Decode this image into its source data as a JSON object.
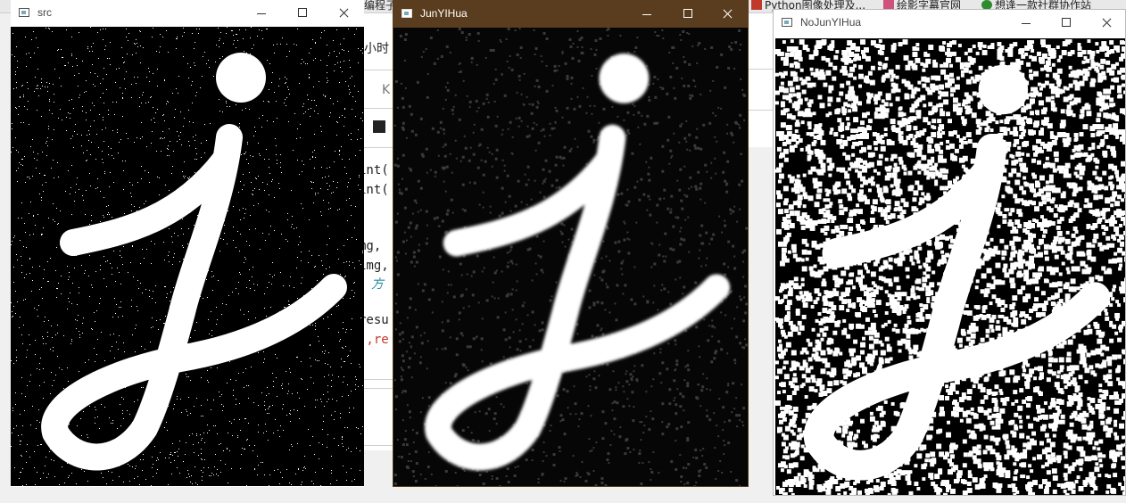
{
  "background": {
    "tabs": [
      {
        "label": "编程子",
        "color": "#c07a2a"
      },
      {
        "label": "Python图像处理及...",
        "color": "#c0392b"
      },
      {
        "label": "绘影字幕官网",
        "color": "#d0517a"
      },
      {
        "label": "想逢一款社群协作站",
        "color": "#2e8b2e"
      }
    ],
    "editor_fragments": [
      "小时",
      "K",
      "int(",
      "int(",
      "mg,",
      "img,",
      "方",
      "resu",
      "',re"
    ]
  },
  "windows": {
    "src": {
      "title": "src"
    },
    "junyihua": {
      "title": "JunYIHua"
    },
    "nojunyihua": {
      "title": "NoJunYIHua"
    }
  },
  "colors": {
    "active_titlebar": "#5a3d1e",
    "glyph": "#ffffff",
    "canvas": "#000000"
  }
}
